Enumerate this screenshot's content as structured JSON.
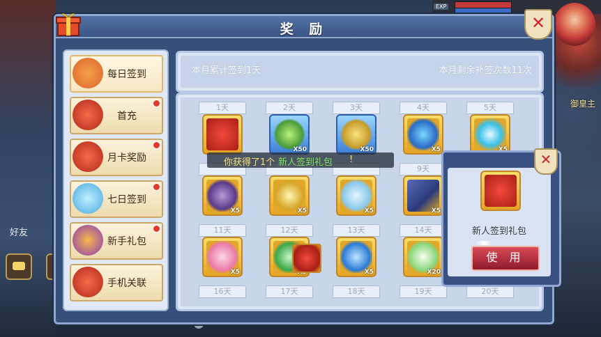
{
  "window": {
    "title": "奖 励"
  },
  "hud": {
    "exp_label": "EXP",
    "friend_label": "好友",
    "main_label": "御皇主"
  },
  "menu": {
    "items": [
      {
        "label": "每日签到",
        "icon": "coin-pouch-icon",
        "active": true,
        "reddot": false
      },
      {
        "label": "首充",
        "icon": "gift-bag-icon",
        "active": false,
        "reddot": true
      },
      {
        "label": "月卡奖励",
        "icon": "gift-bag-icon",
        "active": false,
        "reddot": true
      },
      {
        "label": "七日签到",
        "icon": "blue-bag-icon",
        "active": false,
        "reddot": true
      },
      {
        "label": "新手礼包",
        "icon": "egg-icon",
        "active": false,
        "reddot": true
      },
      {
        "label": "手机关联",
        "icon": "gift-bag-icon",
        "active": false,
        "reddot": false
      }
    ]
  },
  "info": {
    "left": "本月累计签到1天",
    "right": "本月剩余补签次数11次"
  },
  "grid": {
    "cells": [
      {
        "day": "1天",
        "item": "gift-box-icon",
        "qty": "",
        "frame": "gold"
      },
      {
        "day": "2天",
        "item": "green-beans-icon",
        "qty": "X50",
        "frame": "blue"
      },
      {
        "day": "3天",
        "item": "gold-beans-icon",
        "qty": "X50",
        "frame": "blue"
      },
      {
        "day": "4天",
        "item": "blue-feather-icon",
        "qty": "X5",
        "frame": "gold"
      },
      {
        "day": "5天",
        "item": "blue-orb-icon",
        "qty": "X5",
        "frame": "gold"
      },
      {
        "day": "",
        "item": "purple-stone-icon",
        "qty": "X5",
        "frame": "gold"
      },
      {
        "day": "",
        "item": "gold-crystal-icon",
        "qty": "X5",
        "frame": "gold"
      },
      {
        "day": "",
        "item": "ghost-icon",
        "qty": "X5",
        "frame": "gold"
      },
      {
        "day": "9天",
        "item": "scroll-icon",
        "qty": "X5",
        "frame": "gold"
      },
      {
        "day": "11天",
        "item": "pink-pet-icon",
        "qty": "X5",
        "frame": "gold"
      },
      {
        "day": "12天",
        "item": "green-gem-icon",
        "qty": "X5",
        "frame": "gold"
      },
      {
        "day": "13天",
        "item": "blue-egg-icon",
        "qty": "X5",
        "frame": "gold"
      },
      {
        "day": "14天",
        "item": "herb-icon",
        "qty": "X20",
        "frame": "gold"
      },
      {
        "day": "16天",
        "item": "",
        "qty": "",
        "frame": ""
      },
      {
        "day": "17天",
        "item": "",
        "qty": "",
        "frame": ""
      },
      {
        "day": "18天",
        "item": "",
        "qty": "",
        "frame": ""
      },
      {
        "day": "19天",
        "item": "",
        "qty": "",
        "frame": ""
      },
      {
        "day": "20天",
        "item": "",
        "qty": "",
        "frame": ""
      }
    ]
  },
  "toast": {
    "part1": "你获得了1个",
    "part2": "新人签到礼包",
    "part3": "!"
  },
  "popup": {
    "item_name": "新人签到礼包",
    "use_label": "使 用"
  },
  "colors": {
    "accent_gold": "#e3a626",
    "button_red": "#8e1a2a",
    "panel_blue": "#37507a"
  }
}
